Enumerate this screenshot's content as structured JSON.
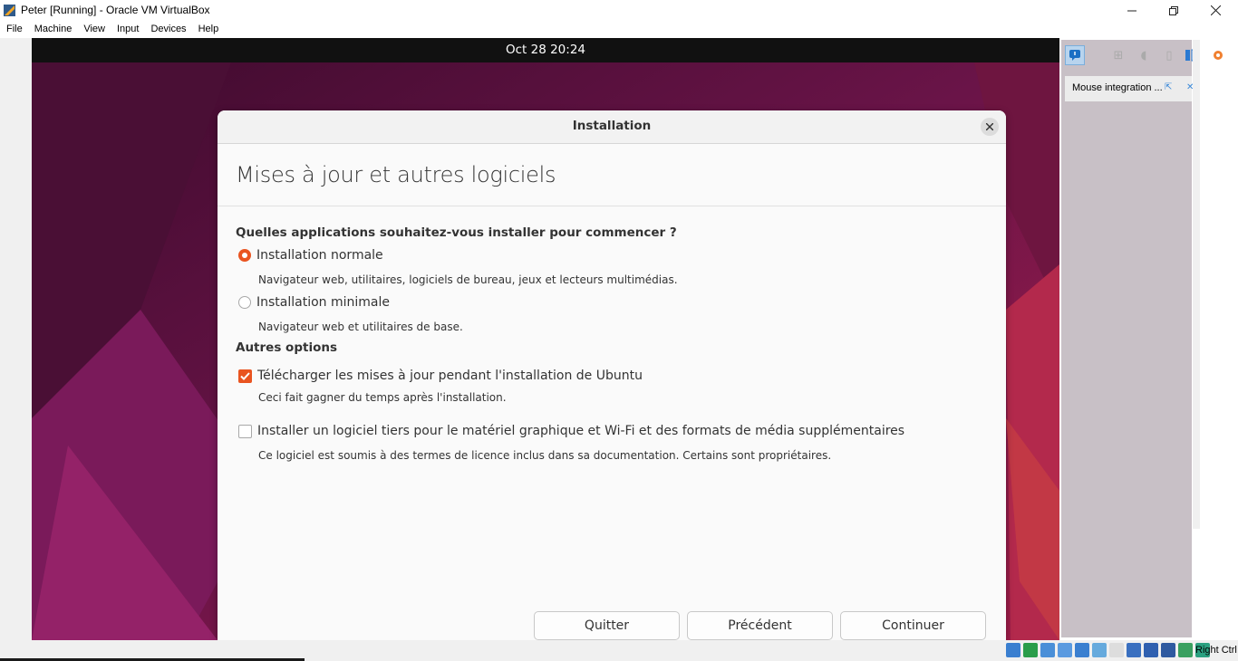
{
  "window": {
    "title": "Peter [Running] - Oracle VM VirtualBox",
    "min_icon": "minimize-icon",
    "max_icon": "maximize-icon",
    "close_icon": "close-icon"
  },
  "menubar": [
    "File",
    "Machine",
    "View",
    "Input",
    "Devices",
    "Help"
  ],
  "guest_topbar": {
    "clock": "Oct 28  20:24"
  },
  "dialog": {
    "title": "Installation",
    "heading": "Mises à jour et autres logiciels",
    "question": "Quelles applications souhaitez-vous installer pour commencer ?",
    "options": [
      {
        "label": "Installation normale",
        "desc": "Navigateur web, utilitaires, logiciels de bureau, jeux et lecteurs multimédias.",
        "selected": true
      },
      {
        "label": "Installation minimale",
        "desc": "Navigateur web et utilitaires de base.",
        "selected": false
      }
    ],
    "other_title": "Autres options",
    "checks": [
      {
        "label": "Télécharger les mises à jour pendant l'installation de Ubuntu",
        "desc": "Ceci fait gagner du temps après l'installation.",
        "checked": true
      },
      {
        "label": "Installer un logiciel tiers pour le matériel graphique et Wi-Fi et des formats de média supplémentaires",
        "desc": "Ce logiciel est soumis à des termes de licence inclus dans sa documentation. Certains sont propriétaires.",
        "checked": false
      }
    ],
    "buttons": {
      "quit": "Quitter",
      "back": "Précédent",
      "continue": "Continuer"
    },
    "accent": "#e95420"
  },
  "sidepanel": {
    "notification": "Mouse integration ..."
  },
  "statusbar": {
    "host_key": "Right Ctrl"
  }
}
